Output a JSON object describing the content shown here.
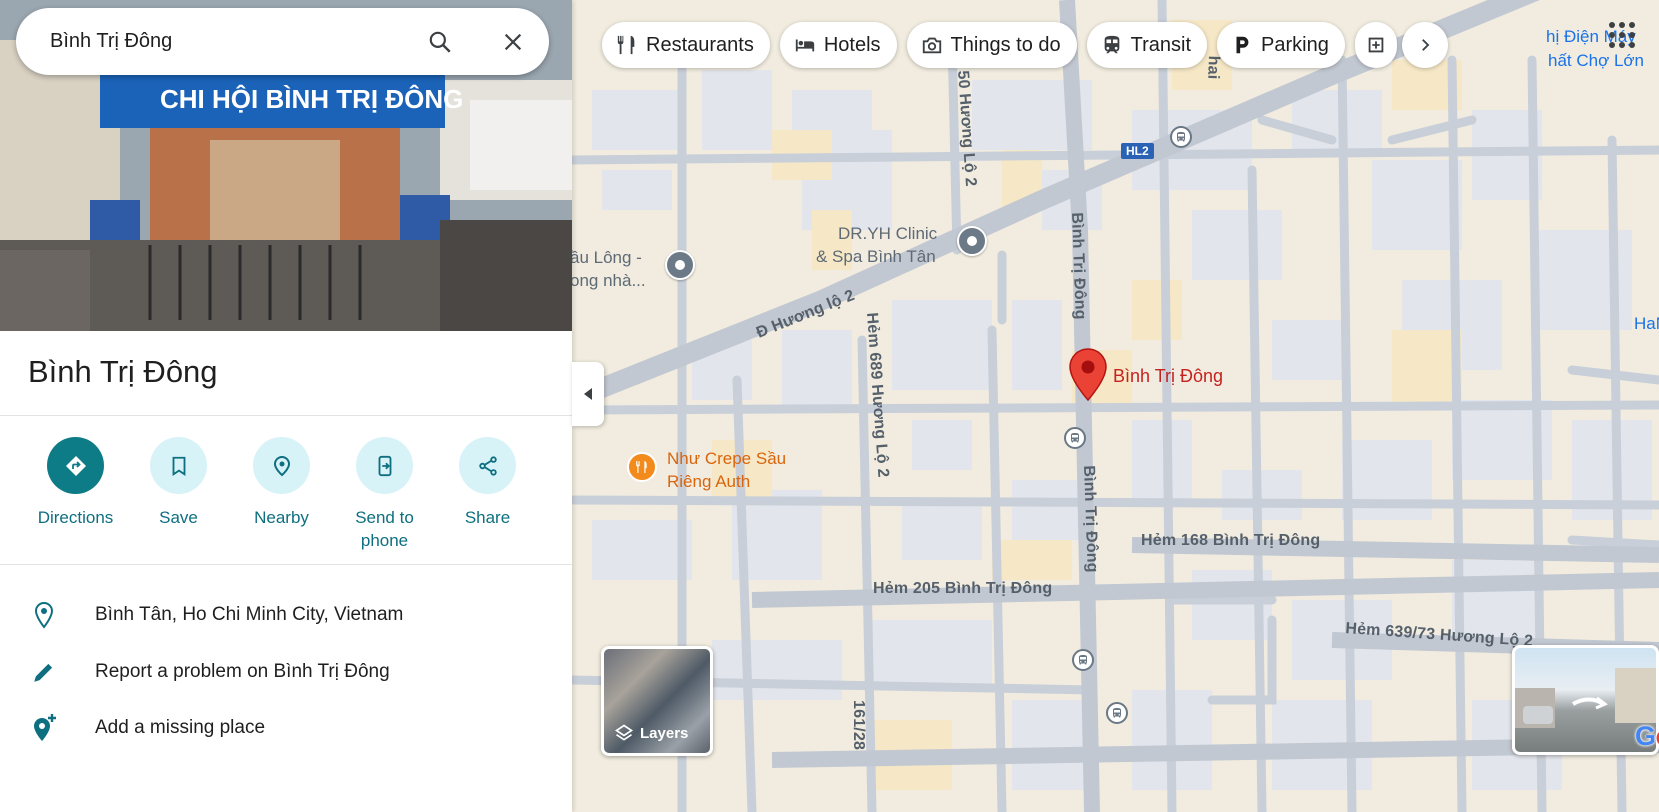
{
  "search": {
    "value": "Bình Trị Đông"
  },
  "place": {
    "title": "Bình Trị Đông",
    "photo_sign": "CHI HỘI BÌNH TRỊ ĐÔNG"
  },
  "actions": [
    {
      "label": "Directions",
      "icon": "directions-icon"
    },
    {
      "label": "Save",
      "icon": "bookmark-icon"
    },
    {
      "label": "Nearby",
      "icon": "nearby-icon"
    },
    {
      "label": "Send to phone",
      "icon": "send-to-phone-icon"
    },
    {
      "label": "Share",
      "icon": "share-icon"
    }
  ],
  "info": {
    "address": "Bình Tân, Ho Chi Minh City, Vietnam",
    "report": "Report a problem on Bình Trị Đông",
    "add_place": "Add a missing place"
  },
  "chips": [
    {
      "label": "Restaurants",
      "icon": "fork-knife-icon"
    },
    {
      "label": "Hotels",
      "icon": "bed-icon"
    },
    {
      "label": "Things to do",
      "icon": "camera-icon"
    },
    {
      "label": "Transit",
      "icon": "train-icon"
    },
    {
      "label": "Parking",
      "icon": "parking-icon"
    }
  ],
  "map": {
    "selected_place": "Bình Trị Đông",
    "poi_clinic": "DR.YH Clinic\n& Spa Bình Tân",
    "poi_clinic_l1": "DR.YH Clinic",
    "poi_clinic_l2": "& Spa Bình Tân",
    "poi_left_l1": "ầu Lông -",
    "poi_left_l2": "ong nhà...",
    "poi_crepe_l1": "Như Crepe Sầu",
    "poi_crepe_l2": "Riêng Auth",
    "poi_topright_l1": "hị Điện Máy",
    "poi_topright_l2": "hất Chợ Lớn",
    "poi_han": "HaN",
    "road_huong_lo_2": "Đ Hương lộ 2",
    "road_btd_vertical_top": "Bình Trị Đông",
    "road_btd_vertical_bottom": "Bình Trị Đông",
    "road_hem_168": "Hẻm 168 Bình Trị Đông",
    "road_hem_205": "Hẻm 205 Bình Trị Đông",
    "road_hem_689": "Hẻm 689 Hương Lộ 2",
    "road_hem_650": "50 Hương Lộ 2",
    "road_hem_639": "Hẻm 639/73 Hương Lộ 2",
    "road_hai": "hai",
    "road_161": "161/28",
    "hl2_badge": "HL2",
    "layers_label": "Layers",
    "google": "Google"
  },
  "colors": {
    "accent": "#0e7c86",
    "pin_red": "#ea4335",
    "poi_orange": "#e8710a",
    "map_bg": "#f1ecdf",
    "road": "#c7ccd5"
  }
}
